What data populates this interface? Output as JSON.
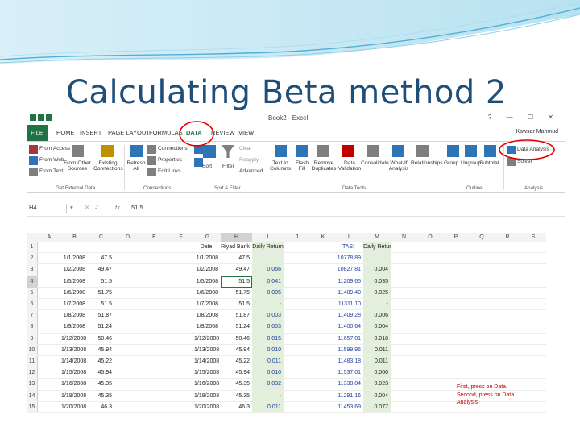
{
  "slide": {
    "title": "Calculating Beta method 2"
  },
  "excel": {
    "doc_title": "Book2 - Excel",
    "window_controls": "?  —  ☐  ✕",
    "user": "Kawsar Mahmud",
    "tabs": [
      "FILE",
      "HOME",
      "INSERT",
      "PAGE LAYOUT",
      "FORMULAS",
      "DATA",
      "REVIEW",
      "VIEW"
    ],
    "ribbon": {
      "get_external": [
        "From Access",
        "From Web",
        "From Text",
        "From Other Sources",
        "Existing Connections"
      ],
      "get_external_label": "Get External Data",
      "connections": [
        "Refresh All",
        "Connections",
        "Properties",
        "Edit Links"
      ],
      "connections_label": "Connections",
      "sort_filter": [
        "Sort",
        "Filter",
        "Clear",
        "Reapply",
        "Advanced"
      ],
      "sort_filter_label": "Sort & Filter",
      "data_tools": [
        "Text to Columns",
        "Flash Fill",
        "Remove Duplicates",
        "Data Validation",
        "Consolidate",
        "What-If Analysis",
        "Relationships"
      ],
      "data_tools_label": "Data Tools",
      "outline": [
        "Group",
        "Ungroup",
        "Subtotal"
      ],
      "outline_label": "Outline",
      "analysis": [
        "Data Analysis",
        "Solver"
      ],
      "analysis_label": "Analysis"
    },
    "name_box": "H4",
    "fx": "fx",
    "formula_value": "51.5",
    "columns": [
      "A",
      "B",
      "C",
      "D",
      "E",
      "F",
      "G",
      "H",
      "I",
      "J",
      "K",
      "L",
      "M",
      "N",
      "O",
      "P",
      "Q",
      "R",
      "S"
    ],
    "rows": [
      {
        "n": "1",
        "B": "",
        "C": "",
        "G": "Date",
        "H": "Riyad Bank",
        "I": "Daily Return",
        "L": "TASI",
        "M": "Daily Return"
      },
      {
        "n": "2",
        "B": "1/1/2008",
        "C": "47.5",
        "G": "1/1/2008",
        "H": "47.5",
        "I": "",
        "L": "10778.89",
        "M": ""
      },
      {
        "n": "3",
        "B": "1/2/2008",
        "C": "49.47",
        "G": "1/2/2008",
        "H": "49.47",
        "I": "0.066",
        "L": "10827.81",
        "M": "0.004"
      },
      {
        "n": "4",
        "B": "1/5/2008",
        "C": "51.5",
        "G": "1/5/2008",
        "H": "51.5",
        "I": "0.041",
        "L": "11209.65",
        "M": "0.035"
      },
      {
        "n": "5",
        "B": "1/6/2008",
        "C": "51.75",
        "G": "1/6/2008",
        "H": "51.75",
        "I": "0.005",
        "L": "11489.40",
        "M": "0.025"
      },
      {
        "n": "6",
        "B": "1/7/2008",
        "C": "51.5",
        "G": "1/7/2008",
        "H": "51.5",
        "I": "-",
        "L": "11311.10",
        "M": "-"
      },
      {
        "n": "7",
        "B": "1/8/2008",
        "C": "51.87",
        "G": "1/8/2008",
        "H": "51.87",
        "I": "0.003",
        "L": "11409.28",
        "M": "0.006"
      },
      {
        "n": "8",
        "B": "1/9/2008",
        "C": "51.24",
        "G": "1/9/2008",
        "H": "51.24",
        "I": "0.003",
        "L": "11400.64",
        "M": "0.004"
      },
      {
        "n": "9",
        "B": "1/12/2008",
        "C": "50.46",
        "G": "1/12/2008",
        "H": "50.46",
        "I": "0.015",
        "L": "11657.01",
        "M": "0.018"
      },
      {
        "n": "10",
        "B": "1/13/2008",
        "C": "45.94",
        "G": "1/13/2008",
        "H": "45.94",
        "I": "0.010",
        "L": "11599.96",
        "M": "0.011"
      },
      {
        "n": "11",
        "B": "1/14/2008",
        "C": "45.22",
        "G": "1/14/2008",
        "H": "45.22",
        "I": "0.011",
        "L": "11483.18",
        "M": "0.011"
      },
      {
        "n": "12",
        "B": "1/15/2008",
        "C": "45.94",
        "G": "1/15/2008",
        "H": "45.94",
        "I": "0.010",
        "L": "11537.01",
        "M": "0.000"
      },
      {
        "n": "13",
        "B": "1/16/2008",
        "C": "45.35",
        "G": "1/16/2008",
        "H": "45.35",
        "I": "0.032",
        "L": "11338.84",
        "M": "0.023"
      },
      {
        "n": "14",
        "B": "1/19/2008",
        "C": "45.35",
        "G": "1/19/2008",
        "H": "45.35",
        "I": "-",
        "L": "11291.16",
        "M": "0.004"
      },
      {
        "n": "15",
        "B": "1/20/2008",
        "C": "46.3",
        "G": "1/20/2008",
        "H": "46.3",
        "I": "0.011",
        "L": "11453.69",
        "M": "0.077"
      }
    ],
    "note": [
      "First, press on Data.",
      "Second, press on Data",
      "Analysis"
    ]
  },
  "colors": {
    "excel_green": "#217346",
    "annotation_red": "#e00000",
    "title_blue": "#1f4e79",
    "return_fill": "#e2efda"
  }
}
